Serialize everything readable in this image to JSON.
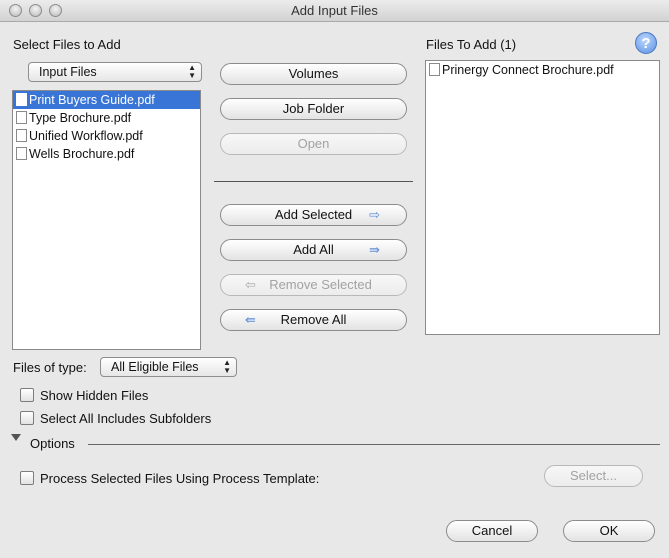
{
  "window": {
    "title": "Add Input Files"
  },
  "left": {
    "heading": "Select Files to Add",
    "source_popup": "Input Files",
    "files": [
      {
        "name": "Print Buyers Guide.pdf",
        "selected": true
      },
      {
        "name": "Type Brochure.pdf",
        "selected": false
      },
      {
        "name": "Unified Workflow.pdf",
        "selected": false
      },
      {
        "name": "Wells Brochure.pdf",
        "selected": false
      }
    ]
  },
  "middle": {
    "volumes": "Volumes",
    "job_folder": "Job Folder",
    "open": "Open",
    "add_selected": "Add Selected",
    "add_all": "Add All",
    "remove_selected": "Remove Selected",
    "remove_all": "Remove All"
  },
  "right": {
    "heading": "Files To Add (1)",
    "help": "?",
    "files": [
      {
        "name": "Prinergy Connect Brochure.pdf"
      }
    ]
  },
  "filter": {
    "label": "Files of type:",
    "value": "All Eligible Files",
    "show_hidden": "Show Hidden Files",
    "select_all_subfolders": "Select All Includes Subfolders"
  },
  "options": {
    "label": "Options",
    "process_template": "Process Selected Files Using Process Template:",
    "select_button": "Select..."
  },
  "footer": {
    "cancel": "Cancel",
    "ok": "OK"
  },
  "colors": {
    "selection": "#3875d7",
    "arrow": "#5f8fd6",
    "help": "#5b8fe0"
  }
}
